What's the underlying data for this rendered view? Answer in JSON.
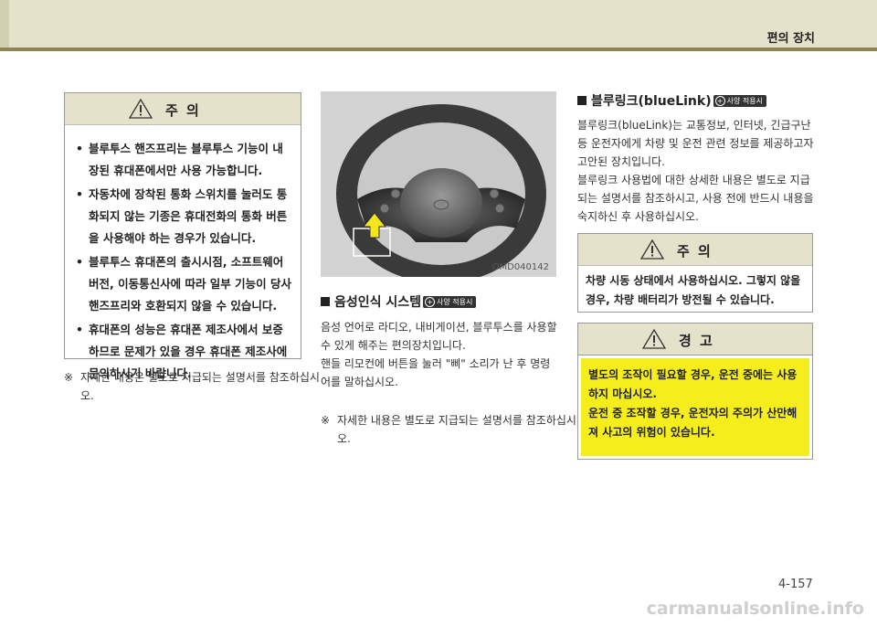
{
  "header": {
    "title": "편의 장치"
  },
  "left": {
    "caution": {
      "title": "주 의",
      "items": [
        "블루투스 핸즈프리는 블루투스 기능이 내장된 휴대폰에서만 사용 가능합니다.",
        "자동차에 장착된 통화 스위치를 눌러도 통화되지 않는 기종은 휴대전화의 통화 버튼을 사용해야 하는 경우가 있습니다.",
        "블루투스 휴대폰의 출시시점, 소프트웨어 버전, 이동통신사에 따라 일부 기능이 당사 핸즈프리와 호환되지 않을 수 있습니다.",
        "휴대폰의 성능은 휴대폰 제조사에서 보증하므로 문제가 있을 경우 휴대폰 제조사에 문의하시기 바랍니다."
      ]
    },
    "note": {
      "mark": "※",
      "text": "자세한 내용은 별도로 지급되는 설명서를 참조하십시오."
    }
  },
  "middle": {
    "photo_code": "OMD040142",
    "section_title": "음성인식 시스템",
    "badge": "사양 적용시",
    "body": [
      "음성 언어로 라디오, 내비게이션, 블루투스를 사용할 수 있게 해주는 편의장치입니다.",
      "핸들 리모컨에 버튼을 눌러 \"삐\" 소리가 난 후 명령어를 말하십시오."
    ],
    "note": {
      "mark": "※",
      "text": "자세한 내용은 별도로 지급되는 설명서를 참조하십시오."
    }
  },
  "right": {
    "section_title": "블루링크(blueLink)",
    "badge": "사양 적용시",
    "body": [
      "블루링크(blueLink)는 교통정보, 인터넷, 긴급구난 등 운전자에게 차량 및 운전 관련 정보를 제공하고자 고안된 장치입니다.",
      "블루링크 사용법에 대한 상세한 내용은 별도로 지급되는 설명서를 참조하시고, 사용 전에 반드시 내용을 숙지하신 후 사용하십시오."
    ],
    "caution": {
      "title": "주 의",
      "text": "차량 시동 상태에서 사용하십시오. 그렇지 않을 경우, 차량 배터리가 방전될 수 있습니다."
    },
    "warning": {
      "title": "경 고",
      "lines": [
        "별도의 조작이 필요할 경우, 운전 중에는 사용하지 마십시오.",
        "운전 중 조작할 경우, 운전자의 주의가 산만해져 사고의 위험이 있습니다."
      ]
    }
  },
  "page_number": "4-157",
  "watermark": "carmanualsonline.info"
}
